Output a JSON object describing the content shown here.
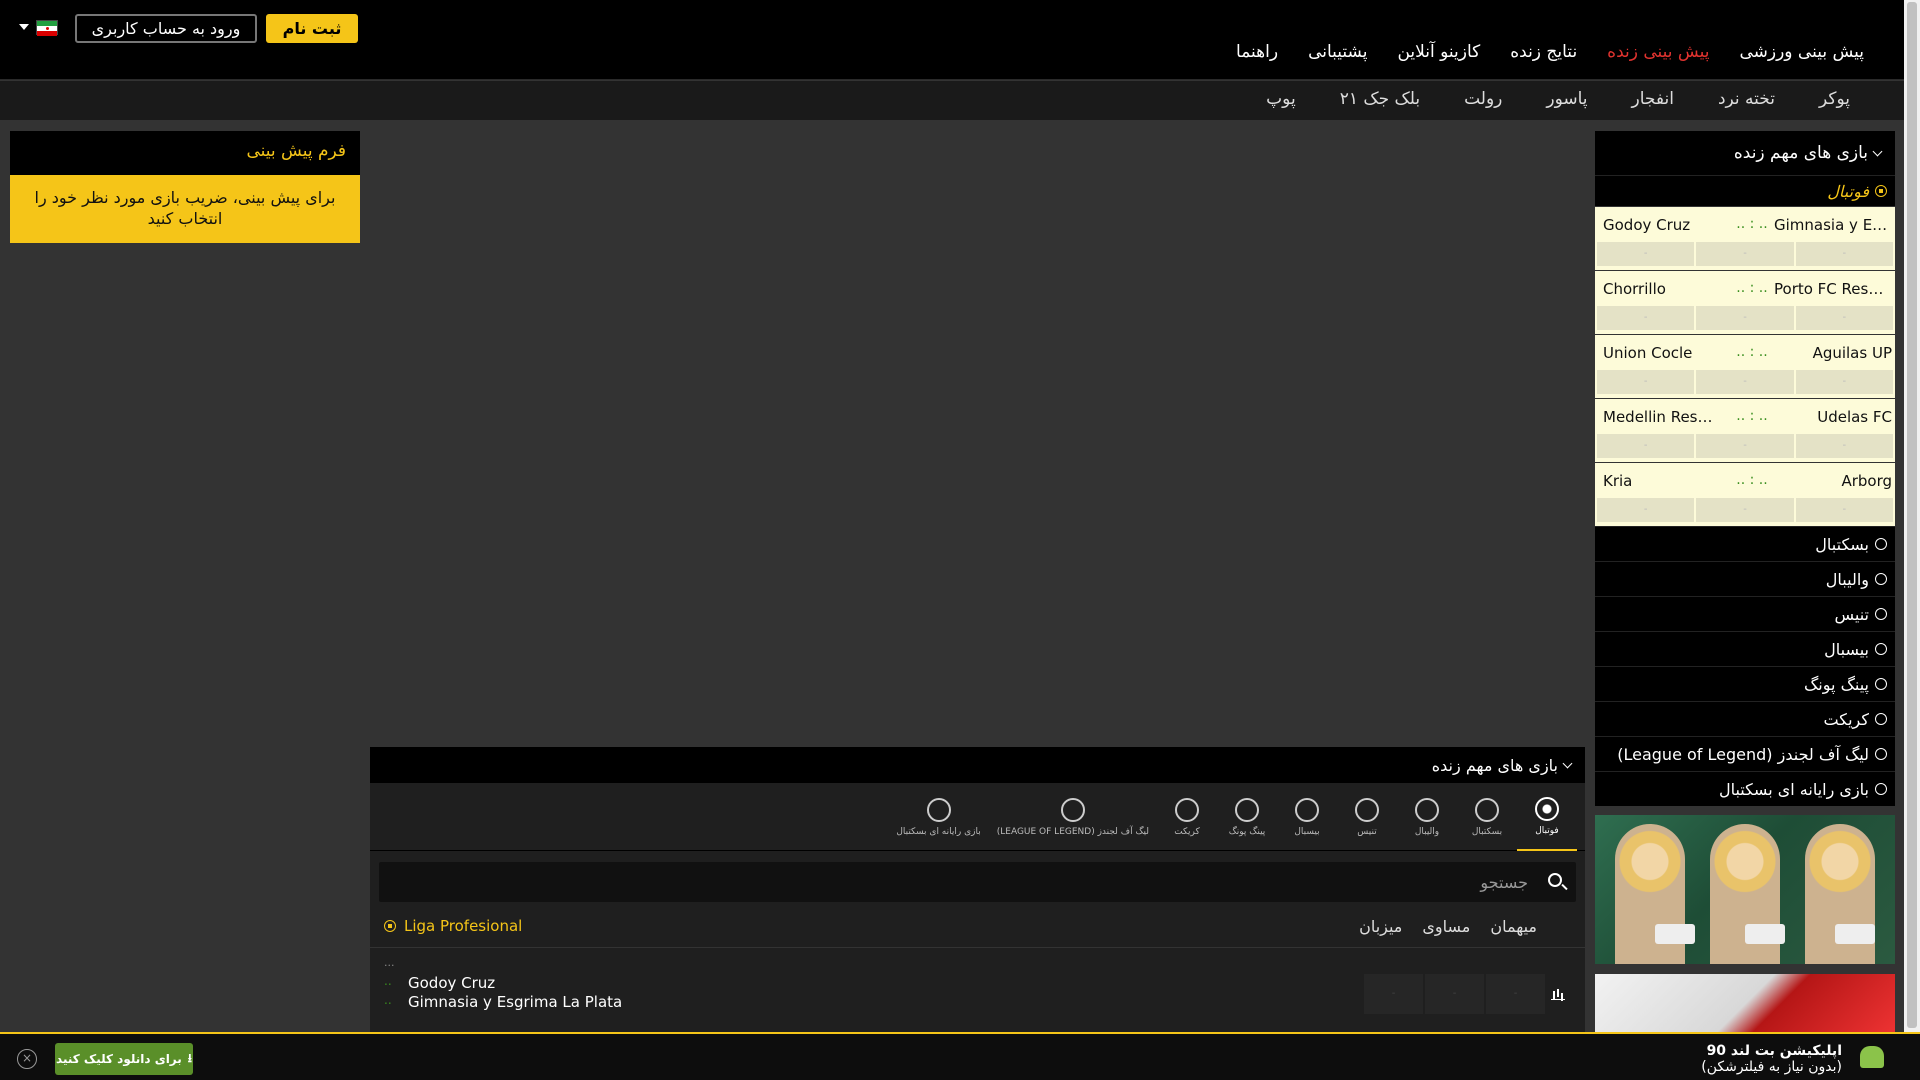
{
  "header": {
    "nav": [
      "پیش بینی ورزشی",
      "پیش بینی زنده",
      "نتایج زنده",
      "کازینو آنلاین",
      "پشتیبانی",
      "راهنما"
    ],
    "active_nav": 1,
    "register_label": "ثبت نام",
    "login_label": "ورود به حساب کاربری"
  },
  "subnav": [
    "پوکر",
    "تخته نرد",
    "انفجار",
    "پاسور",
    "رولت",
    "بلک جک ۲۱",
    "پوپ"
  ],
  "form": {
    "title": "فرم پیش بینی",
    "message": "برای پیش بینی، ضریب بازی مورد نظر خود را انتخاب کنید"
  },
  "sidebar": {
    "title": "بازی های مهم زنده",
    "football_label": "فوتبال",
    "matches": [
      {
        "home": "Gimnasia y Esgrima La Plata",
        "away": "Godoy Cruz",
        "score": "..  :  .."
      },
      {
        "home": "Porto FC Reserves",
        "away": "Chorrillo",
        "score": "..  :  .."
      },
      {
        "home": "Aguilas UP",
        "away": "Union Cocle",
        "score": "..  :  .."
      },
      {
        "home": "Udelas FC",
        "away": "Medellin Reserves",
        "score": "..  :  .."
      },
      {
        "home": "Arborg",
        "away": "Kria",
        "score": "..  :  .."
      }
    ],
    "odd_placeholder": "-",
    "sports": [
      "بسکتبال",
      "والیبال",
      "تنیس",
      "بیسبال",
      "پینگ پونگ",
      "کریکت",
      "لیگ آف لجندز (League of Legend)",
      "بازی رایانه ای بسکتبال"
    ]
  },
  "live": {
    "title": "بازی های مهم زنده",
    "tabs": [
      "فوتبال",
      "بسکتبال",
      "والیبال",
      "تنیس",
      "بیسبال",
      "پینگ پونگ",
      "کریکت",
      "لیگ آف لجندز (LEAGUE OF LEGEND)",
      "بازی رایانه ای بسکتبال"
    ],
    "search_placeholder": "جستجو",
    "league": "Liga Profesional",
    "columns": [
      "میزبان",
      "مساوی",
      "میهمان"
    ],
    "game": {
      "time": "...",
      "team1": "Godoy Cruz",
      "team2": "Gimnasia y Esgrima La Plata",
      "score1": "..",
      "score2": "..",
      "odds": [
        "-",
        "-",
        "-"
      ]
    }
  },
  "appbar": {
    "title": "اپلیکیشن بت لند 90",
    "subtitle": "(بدون نیاز به فیلترشکن)",
    "download_label": "برای دانلود کلیک کنید",
    "close_label": "×"
  }
}
